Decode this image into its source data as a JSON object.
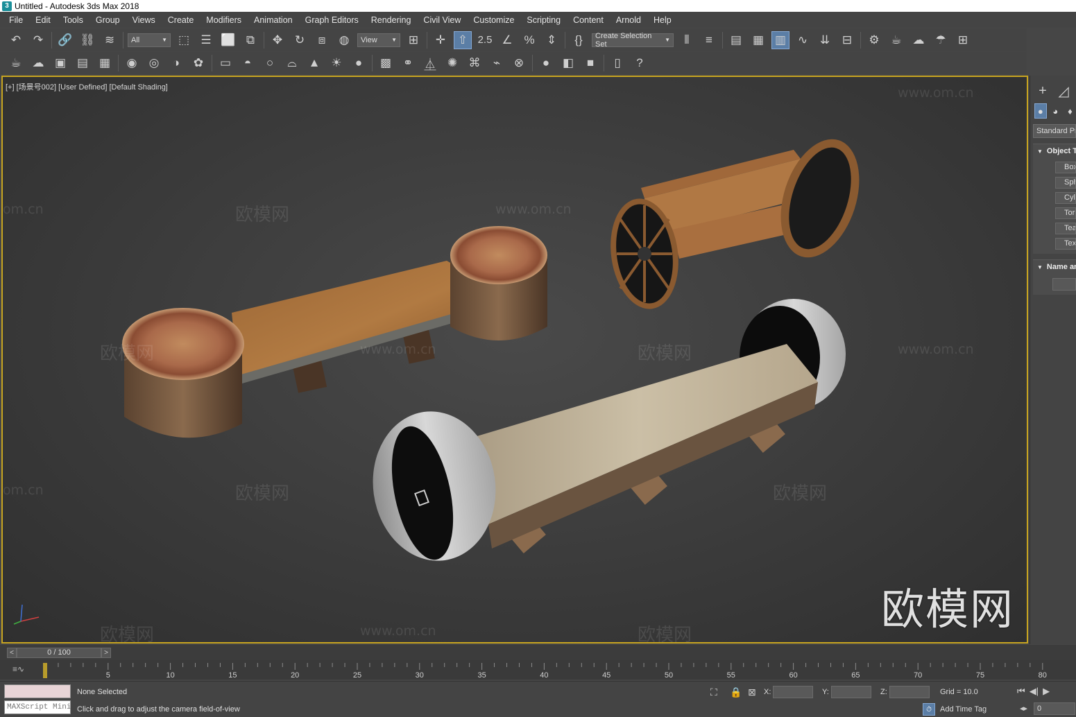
{
  "window": {
    "title": "Untitled - Autodesk 3ds Max 2018",
    "icon_letter": "3"
  },
  "menu": [
    "File",
    "Edit",
    "Tools",
    "Group",
    "Views",
    "Create",
    "Modifiers",
    "Animation",
    "Graph Editors",
    "Rendering",
    "Civil View",
    "Customize",
    "Scripting",
    "Content",
    "Arnold",
    "Help"
  ],
  "toolbar": {
    "filter_dropdown": "All",
    "coord_dropdown": "View",
    "selection_set_dropdown": "Create Selection Set",
    "snap_label": "2.5"
  },
  "viewport": {
    "label": "[+] [场景号002] [User Defined] [Default Shading]",
    "border_color": "#c8a520"
  },
  "watermarks": {
    "site_name": "欧模网",
    "url": "www.om.cn",
    "url_partial": "om.cn",
    "site_partial": "www."
  },
  "command_panel": {
    "category_dropdown": "Standard Primitives",
    "object_type_title": "Object Type",
    "object_buttons": [
      "Box",
      "Sphere",
      "Cylinder",
      "Torus",
      "Teapot",
      "Text"
    ],
    "name_title": "Name and Color"
  },
  "time_slider": {
    "position": "0 / 100",
    "prev": "<",
    "next": ">"
  },
  "track_bar": {
    "ticks": [
      "5",
      "10",
      "15",
      "20",
      "25",
      "30",
      "35",
      "40",
      "45",
      "50",
      "55",
      "60",
      "65",
      "70",
      "75",
      "80"
    ]
  },
  "status": {
    "selection": "None Selected",
    "prompt": "Click and drag to adjust the camera field-of-view",
    "maxscript": "MAXScript Mini",
    "x_label": "X:",
    "y_label": "Y:",
    "z_label": "Z:",
    "grid": "Grid = 10.0",
    "add_time_tag": "Add Time Tag",
    "frame": "0"
  }
}
